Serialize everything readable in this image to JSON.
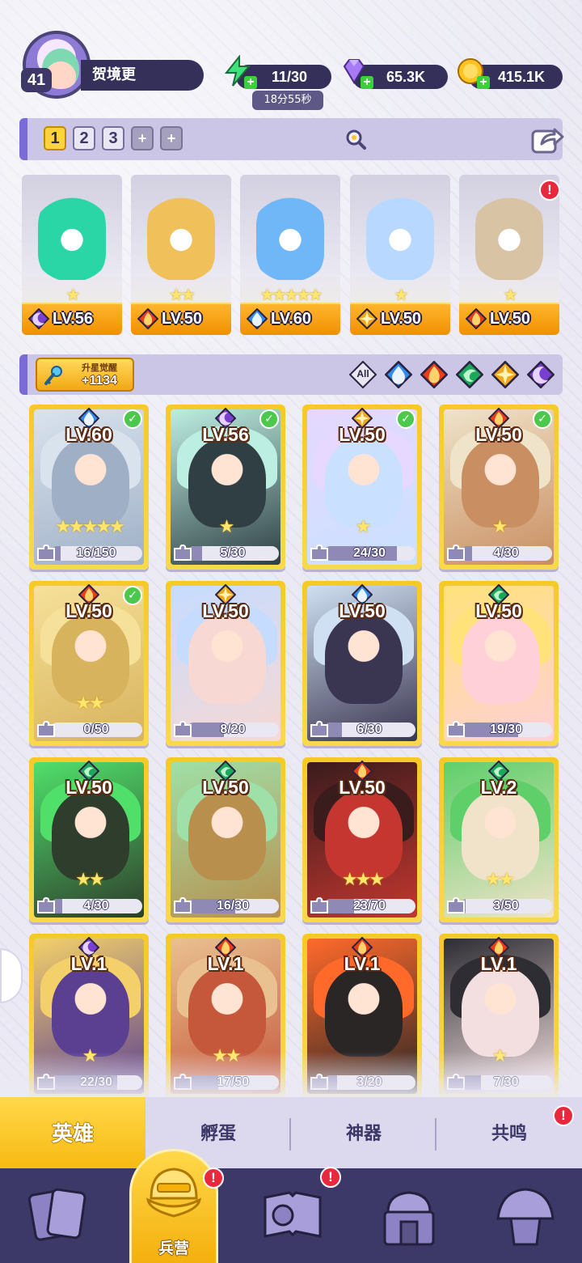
{
  "player": {
    "level": "41",
    "name": "贺境更"
  },
  "resources": {
    "energy": "11/30",
    "energy_timer": "18分55秒",
    "gems": "65.3K",
    "coins": "415.1K"
  },
  "team_slots": [
    "1",
    "2",
    "3",
    "+",
    "+"
  ],
  "team": [
    {
      "level": "LV.56",
      "element": "dark",
      "stars": "★",
      "color": "#2bd6a6"
    },
    {
      "level": "LV.50",
      "element": "fire",
      "stars": "★★",
      "color": "#f0c15a"
    },
    {
      "level": "LV.60",
      "element": "water",
      "stars": "★★★★★",
      "color": "#6fb7f7"
    },
    {
      "level": "LV.50",
      "element": "light",
      "stars": "★",
      "color": "#b9d8ff"
    },
    {
      "level": "LV.50",
      "element": "fire",
      "stars": "★",
      "color": "#d9c3a5"
    }
  ],
  "awaken": {
    "label": "升星觉醒",
    "value": "+1134"
  },
  "filters": [
    "All",
    "water",
    "fire",
    "wind",
    "light",
    "dark"
  ],
  "heroes": [
    {
      "level": "LV.60",
      "element": "water",
      "stars": "★★★★★",
      "frag": "16/150",
      "ratio": 0.11,
      "checked": true,
      "color": "#9fb0c6",
      "hair": "#d9e3ee"
    },
    {
      "level": "LV.56",
      "element": "dark",
      "stars": "★",
      "frag": "5/30",
      "ratio": 0.17,
      "checked": true,
      "color": "#2f3f44",
      "hair": "#bdeee2"
    },
    {
      "level": "LV.50",
      "element": "light",
      "stars": "★",
      "frag": "24/30",
      "ratio": 0.8,
      "checked": true,
      "color": "#c9e1ff",
      "hair": "#e6d8ff"
    },
    {
      "level": "LV.50",
      "element": "fire",
      "stars": "★",
      "frag": "4/30",
      "ratio": 0.13,
      "checked": true,
      "color": "#c98e61",
      "hair": "#efe3c9"
    },
    {
      "level": "LV.50",
      "element": "fire",
      "stars": "★★",
      "frag": "0/50",
      "ratio": 0.0,
      "checked": true,
      "color": "#d7b35d",
      "hair": "#f6e19a"
    },
    {
      "level": "LV.50",
      "element": "light",
      "stars": "",
      "frag": "8/20",
      "ratio": 0.4,
      "checked": false,
      "color": "#f7d8d3",
      "hair": "#c6dcff"
    },
    {
      "level": "LV.50",
      "element": "water",
      "stars": "",
      "frag": "6/30",
      "ratio": 0.2,
      "checked": false,
      "color": "#3a3550",
      "hair": "#cfe0f2"
    },
    {
      "level": "LV.50",
      "element": "wind",
      "stars": "",
      "frag": "19/30",
      "ratio": 0.63,
      "checked": false,
      "color": "#ffd0d8",
      "hair": "#ffe27a"
    },
    {
      "level": "LV.50",
      "element": "wind",
      "stars": "★★",
      "frag": "4/30",
      "ratio": 0.13,
      "checked": false,
      "color": "#2e3d2c",
      "hair": "#50e06a"
    },
    {
      "level": "LV.50",
      "element": "wind",
      "stars": "",
      "frag": "16/30",
      "ratio": 0.53,
      "checked": false,
      "color": "#b88f4c",
      "hair": "#9fe0a8"
    },
    {
      "level": "LV.50",
      "element": "fire",
      "stars": "★★★",
      "frag": "23/70",
      "ratio": 0.33,
      "checked": false,
      "color": "#c4362f",
      "hair": "#3a1c1c"
    },
    {
      "level": "LV.2",
      "element": "wind",
      "stars": "★★",
      "frag": "3/50",
      "ratio": 0.06,
      "checked": false,
      "color": "#f1e3c9",
      "hair": "#5fcf6a"
    },
    {
      "level": "LV.1",
      "element": "dark",
      "stars": "★",
      "frag": "22/30",
      "ratio": 0.73,
      "checked": false,
      "color": "#5b3f91",
      "hair": "#f3d06a"
    },
    {
      "level": "LV.1",
      "element": "fire",
      "stars": "★★",
      "frag": "17/50",
      "ratio": 0.34,
      "checked": false,
      "color": "#c5573b",
      "hair": "#e9c190"
    },
    {
      "level": "LV.1",
      "element": "fire",
      "stars": "",
      "frag": "3/20",
      "ratio": 0.15,
      "checked": false,
      "color": "#2b2626",
      "hair": "#ff6a2b"
    },
    {
      "level": "LV.1",
      "element": "fire",
      "stars": "★",
      "frag": "7/30",
      "ratio": 0.23,
      "checked": false,
      "color": "#f3dfe0",
      "hair": "#2d2d33"
    }
  ],
  "tabs": [
    "英雄",
    "孵蛋",
    "神器",
    "共鸣"
  ],
  "nav": {
    "active_label": "兵营"
  },
  "element_colors": {
    "water": "#2f8cf0",
    "fire": "#ec3c1a",
    "wind": "#1aa85a",
    "light": "#f2a81a",
    "dark": "#7a3fd0"
  }
}
